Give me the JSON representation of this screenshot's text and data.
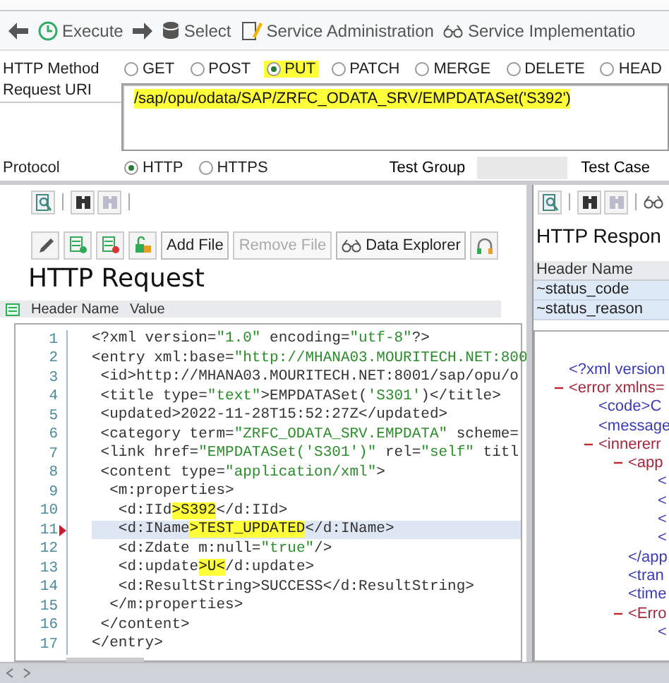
{
  "toolbar": [
    {
      "label": "Execute"
    },
    {
      "label": "Select"
    },
    {
      "label": "Service Administration"
    },
    {
      "label": "Service Implementatio"
    }
  ],
  "http_method": {
    "label": "HTTP Method",
    "options": [
      {
        "label": "GET",
        "selected": false,
        "highlighted": false
      },
      {
        "label": "POST",
        "selected": false,
        "highlighted": false
      },
      {
        "label": "PUT",
        "selected": true,
        "highlighted": true
      },
      {
        "label": "PATCH",
        "selected": false,
        "highlighted": false
      },
      {
        "label": "MERGE",
        "selected": false,
        "highlighted": false
      },
      {
        "label": "DELETE",
        "selected": false,
        "highlighted": false
      },
      {
        "label": "HEAD",
        "selected": false,
        "highlighted": false
      }
    ]
  },
  "request_uri": {
    "label": "Request URI",
    "value": "/sap/opu/odata/SAP/ZRFC_ODATA_SRV/EMPDATASet('S392')",
    "highlighted": true
  },
  "protocol": {
    "label": "Protocol",
    "options": [
      {
        "label": "HTTP",
        "selected": true
      },
      {
        "label": "HTTPS",
        "selected": false
      }
    ]
  },
  "test_group": {
    "label": "Test Group"
  },
  "test_case": {
    "label": "Test Case"
  },
  "request": {
    "buttons": [
      {
        "label": "Add File",
        "disabled": false
      },
      {
        "label": "Remove File",
        "disabled": true
      },
      {
        "label": "Data Explorer",
        "disabled": false
      }
    ],
    "title": "HTTP Request",
    "columns": [
      "Header Name",
      "Value"
    ],
    "editor_lines": [
      {
        "number": "1",
        "selected": false,
        "segments": [
          {
            "kind": "markup",
            "text": "<?xml version="
          },
          {
            "kind": "string",
            "text": "\"1.0\""
          },
          {
            "kind": "markup",
            "text": " encoding="
          },
          {
            "kind": "string",
            "text": "\"utf-8\""
          },
          {
            "kind": "markup",
            "text": "?>"
          }
        ]
      },
      {
        "number": "2",
        "selected": false,
        "segments": [
          {
            "kind": "markup",
            "text": "<entry xml:base="
          },
          {
            "kind": "string",
            "text": "\"http://MHANA03.MOURITECH.NET:800"
          }
        ]
      },
      {
        "number": "3",
        "selected": false,
        "segments": [
          {
            "kind": "markup",
            "text": " <id>http://MHANA03.MOURITECH.NET:8001/sap/opu/o"
          }
        ]
      },
      {
        "number": "4",
        "selected": false,
        "segments": [
          {
            "kind": "markup",
            "text": " <title type="
          },
          {
            "kind": "string",
            "text": "\"text\""
          },
          {
            "kind": "markup",
            "text": ">EMPDATASet("
          },
          {
            "kind": "string",
            "text": "'S301'"
          },
          {
            "kind": "markup",
            "text": ")</title>"
          }
        ]
      },
      {
        "number": "5",
        "selected": false,
        "segments": [
          {
            "kind": "markup",
            "text": " <updated>2022-11-28T15:52:27Z</updated>"
          }
        ]
      },
      {
        "number": "6",
        "selected": false,
        "segments": [
          {
            "kind": "markup",
            "text": " <category term="
          },
          {
            "kind": "string",
            "text": "\"ZRFC_ODATA_SRV.EMPDATA\""
          },
          {
            "kind": "markup",
            "text": " scheme="
          }
        ]
      },
      {
        "number": "7",
        "selected": false,
        "segments": [
          {
            "kind": "markup",
            "text": " <link href="
          },
          {
            "kind": "string",
            "text": "\"EMPDATASet('S301')\""
          },
          {
            "kind": "markup",
            "text": " rel="
          },
          {
            "kind": "string",
            "text": "\"self\""
          },
          {
            "kind": "markup",
            "text": " titl"
          }
        ]
      },
      {
        "number": "8",
        "selected": false,
        "segments": [
          {
            "kind": "markup",
            "text": " <content type="
          },
          {
            "kind": "string",
            "text": "\"application/xml\""
          },
          {
            "kind": "markup",
            "text": ">"
          }
        ]
      },
      {
        "number": "9",
        "selected": false,
        "segments": [
          {
            "kind": "markup",
            "text": "  <m:properties>"
          }
        ]
      },
      {
        "number": "10",
        "selected": false,
        "segments": [
          {
            "kind": "markup",
            "text": "   <d:IId"
          },
          {
            "kind": "highlight",
            "text": ">S392"
          },
          {
            "kind": "markup",
            "text": "</d:IId>"
          }
        ]
      },
      {
        "number": "11",
        "selected": true,
        "segments": [
          {
            "kind": "markup",
            "text": "   <d:IName"
          },
          {
            "kind": "highlight",
            "text": ">TEST_UPDATED"
          },
          {
            "kind": "markup",
            "text": "</d:IName>"
          }
        ]
      },
      {
        "number": "12",
        "selected": false,
        "segments": [
          {
            "kind": "markup",
            "text": "   <d:Zdate m:null="
          },
          {
            "kind": "string",
            "text": "\"true\""
          },
          {
            "kind": "markup",
            "text": "/>"
          }
        ]
      },
      {
        "number": "13",
        "selected": false,
        "segments": [
          {
            "kind": "markup",
            "text": "   <d:update"
          },
          {
            "kind": "highlight",
            "text": ">U<"
          },
          {
            "kind": "markup",
            "text": "/d:update>"
          }
        ]
      },
      {
        "number": "14",
        "selected": false,
        "segments": [
          {
            "kind": "markup",
            "text": "   <d:ResultString>SUCCESS</d:ResultString>"
          }
        ]
      },
      {
        "number": "15",
        "selected": false,
        "segments": [
          {
            "kind": "markup",
            "text": "  </m:properties>"
          }
        ]
      },
      {
        "number": "16",
        "selected": false,
        "segments": [
          {
            "kind": "markup",
            "text": " </content>"
          }
        ]
      },
      {
        "number": "17",
        "selected": false,
        "segments": [
          {
            "kind": "markup",
            "text": "</entry>"
          }
        ]
      }
    ]
  },
  "response": {
    "title": "HTTP Respon",
    "columns": [
      "Header Name"
    ],
    "rows": [
      "~status_code",
      "~status_reason"
    ],
    "xml_tree": [
      {
        "text": "<?xml version"
      },
      {
        "text": "<error xmlns=",
        "expanded": true,
        "children": [
          {
            "text": "<code>C"
          },
          {
            "text": "<message"
          },
          {
            "text": "<innererr",
            "expanded": true,
            "children": [
              {
                "text": "<app",
                "expanded": true,
                "children": [
                  {
                    "text": "<"
                  },
                  {
                    "text": "<"
                  },
                  {
                    "text": "<"
                  },
                  {
                    "text": "<"
                  }
                ]
              },
              {
                "text": "</app"
              },
              {
                "text": "<tran"
              },
              {
                "text": "<time"
              },
              {
                "text": "<Erro",
                "expanded": true,
                "children": [
                  {
                    "text": "<"
                  }
                ]
              }
            ]
          }
        ]
      }
    ]
  }
}
